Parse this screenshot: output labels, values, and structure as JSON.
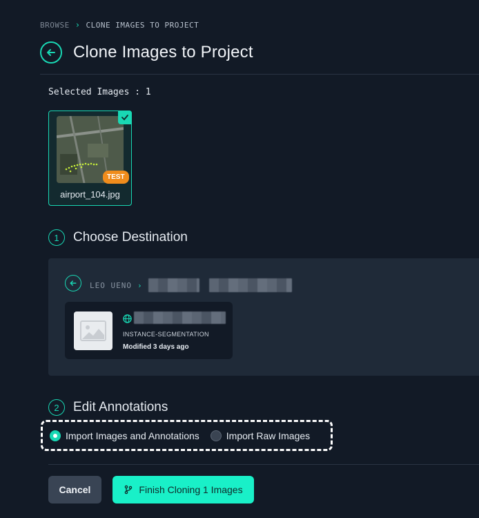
{
  "breadcrumb": {
    "root": "BROWSE",
    "current": "CLONE IMAGES TO PROJECT"
  },
  "header": {
    "title": "Clone Images to Project"
  },
  "selection": {
    "label": "Selected Images : 1",
    "images": [
      {
        "name": "airport_104.jpg",
        "badge": "TEST"
      }
    ]
  },
  "steps": [
    {
      "number": "1",
      "title": "Choose Destination"
    },
    {
      "number": "2",
      "title": "Edit Annotations"
    }
  ],
  "destination": {
    "path_root": "LEO UENO",
    "project": {
      "type": "INSTANCE-SEGMENTATION",
      "modified": "Modified 3 days ago"
    }
  },
  "annotations": {
    "options": [
      {
        "label": "Import Images and Annotations",
        "selected": true
      },
      {
        "label": "Import Raw Images",
        "selected": false
      }
    ]
  },
  "actions": {
    "cancel": "Cancel",
    "finish": "Finish Cloning 1 Images"
  },
  "colors": {
    "accent": "#19d8b4",
    "background": "#121a26",
    "panel": "#1f2a38",
    "badge": "#f08c1c"
  }
}
